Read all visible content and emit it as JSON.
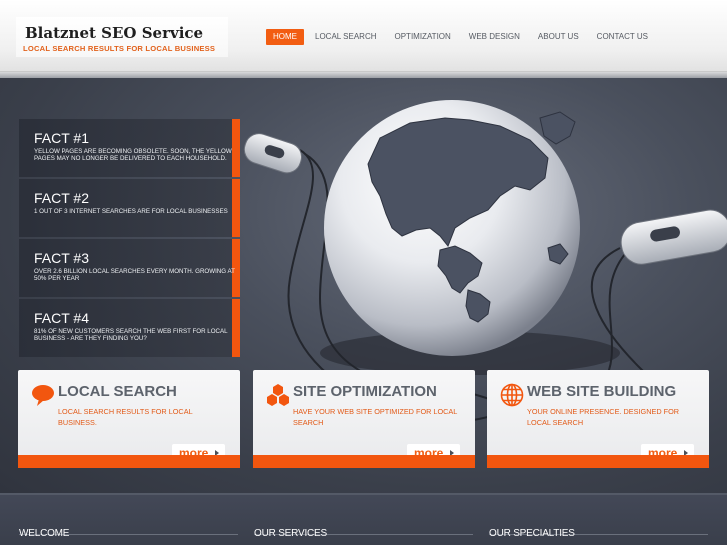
{
  "brand": {
    "title": "Blatznet SEO Service",
    "subtitle": "LOCAL SEARCH RESULTS FOR LOCAL BUSINESS"
  },
  "nav": {
    "items": [
      {
        "label": "HOME",
        "active": true
      },
      {
        "label": "LOCAL SEARCH"
      },
      {
        "label": "OPTIMIZATION"
      },
      {
        "label": "WEB DESIGN"
      },
      {
        "label": "ABOUT US"
      },
      {
        "label": "CONTACT US"
      }
    ]
  },
  "facts": [
    {
      "title": "FACT #1",
      "text": "YELLOW PAGES ARE BECOMING OBSOLETE. SOON, THE YELLOW PAGES MAY NO LONGER BE DELIVERED TO EACH HOUSEHOLD."
    },
    {
      "title": "FACT #2",
      "text": "1 OUT OF 3 INTERNET SEARCHES ARE FOR LOCAL BUSINESSES"
    },
    {
      "title": "FACT #3",
      "text": "OVER 2.6 BILLION LOCAL SEARCHES EVERY MONTH. GROWING AT 50% PER YEAR"
    },
    {
      "title": "FACT #4",
      "text": "81% OF NEW CUSTOMERS SEARCH THE WEB FIRST FOR LOCAL BUSINESS - ARE THEY FINDING YOU?"
    }
  ],
  "services": [
    {
      "title": "LOCAL SEARCH",
      "text": "LOCAL SEARCH RESULTS FOR LOCAL BUSINESS.",
      "more": "more",
      "icon": "speech-bubble-icon"
    },
    {
      "title": "SITE OPTIMIZATION",
      "text": "HAVE YOUR WEB SITE OPTIMIZED FOR LOCAL SEARCH",
      "more": "more",
      "icon": "hexagons-icon"
    },
    {
      "title": "WEB SITE BUILDING",
      "text": "YOUR ONLINE PRESENCE. DESIGNED FOR LOCAL SEARCH",
      "more": "more",
      "icon": "globe-icon"
    }
  ],
  "footer": {
    "columns": [
      "WELCOME",
      "OUR SERVICES",
      "OUR SPECIALTIES"
    ]
  },
  "colors": {
    "accent": "#f2560f",
    "dark": "#3a3f4b",
    "heading_gray": "#5d636c"
  }
}
